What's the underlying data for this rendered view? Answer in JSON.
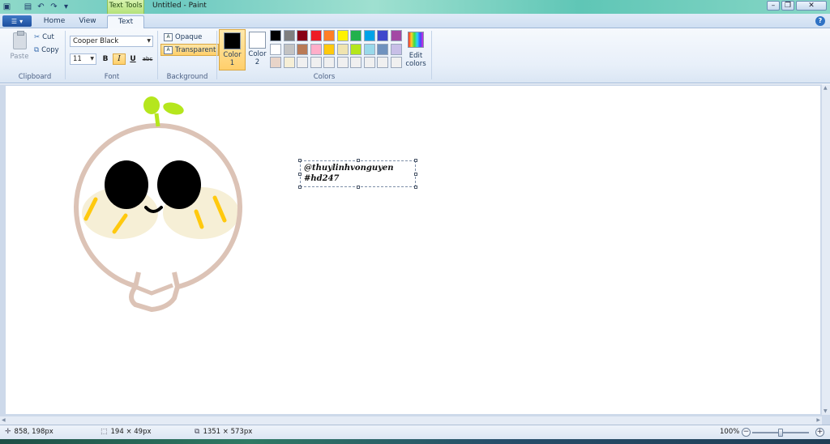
{
  "titlebar": {
    "context_tab": "Text Tools",
    "title": "Untitled - Paint",
    "minimize": "–",
    "maximize": "❐",
    "close": "✕"
  },
  "tabs": {
    "menu_label": "▾",
    "items": [
      {
        "label": "Home"
      },
      {
        "label": "View"
      },
      {
        "label": "Text"
      }
    ],
    "help": "?"
  },
  "ribbon": {
    "clipboard": {
      "paste": "Paste",
      "cut": "Cut",
      "copy": "Copy",
      "group_label": "Clipboard"
    },
    "font": {
      "family": "Cooper Black",
      "size": "11",
      "bold": "B",
      "italic": "I",
      "underline": "U",
      "strike": "abc",
      "group_label": "Font"
    },
    "background": {
      "opaque": "Opaque",
      "transparent": "Transparent",
      "group_label": "Background"
    },
    "colors": {
      "color1_label": "Color",
      "color1_num": "1",
      "color2_label": "Color",
      "color2_num": "2",
      "color1": "#000000",
      "color2": "#ffffff",
      "edit_label_1": "Edit",
      "edit_label_2": "colors",
      "group_label": "Colors",
      "palette": [
        "#000000",
        "#7f7f7f",
        "#880015",
        "#ed1c24",
        "#ff7f27",
        "#fff200",
        "#22b14c",
        "#00a2e8",
        "#3f48cc",
        "#a349a4",
        "#ffffff",
        "#c3c3c3",
        "#b97a57",
        "#ffaec9",
        "#ffc90e",
        "#efe4b0",
        "#b5e61d",
        "#99d9ea",
        "#7092be",
        "#c8bfe7",
        "#e8d4c8",
        "#f6efd6",
        "#f0f0f0",
        "#f0f0f0",
        "#f0f0f0",
        "#f0f0f0",
        "#f0f0f0",
        "#f0f0f0",
        "#f0f0f0",
        "#f0f0f0"
      ]
    }
  },
  "canvas": {
    "text_line_1": "@thuylinhvonguyen",
    "text_line_2": "#hd247"
  },
  "statusbar": {
    "cursor_pos": "858, 198px",
    "selection_size": "194 × 49px",
    "image_size": "1351 × 573px",
    "zoom": "100%",
    "zoom_out": "−",
    "zoom_in": "+",
    "zoom_level": 0.5
  }
}
